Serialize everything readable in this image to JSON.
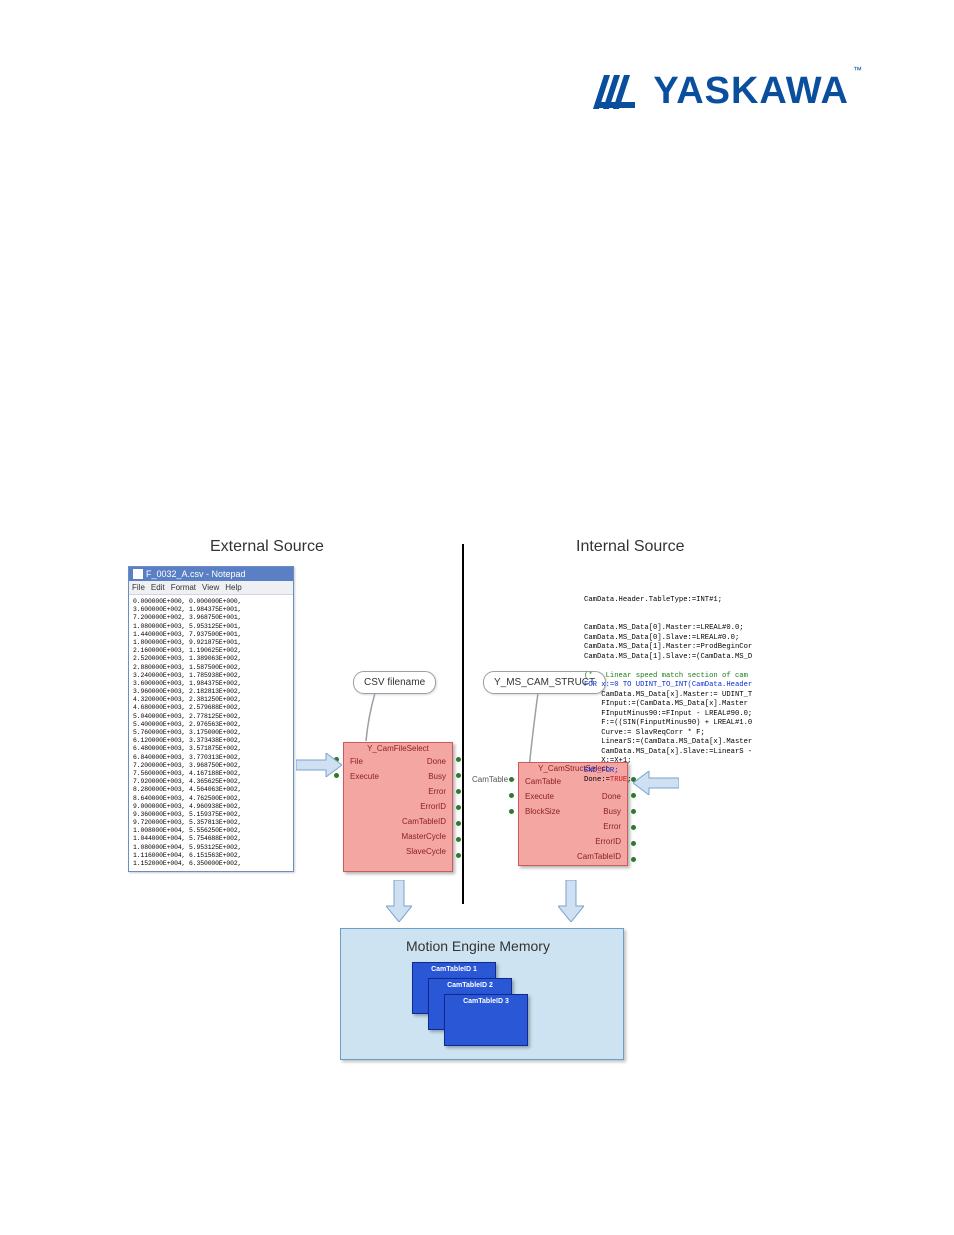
{
  "logo": {
    "brand": "YASKAWA",
    "tm": "™"
  },
  "headings": {
    "external": "External Source",
    "internal": "Internal Source"
  },
  "notepad": {
    "title": "F_0032_A.csv - Notepad",
    "menu": [
      "File",
      "Edit",
      "Format",
      "View",
      "Help"
    ],
    "lines": [
      "0.000000E+000, 0.000000E+000,",
      "3.600000E+002, 1.984375E+001,",
      "7.200000E+002, 3.968750E+001,",
      "1.080000E+003, 5.953125E+001,",
      "1.440000E+003, 7.937500E+001,",
      "1.800000E+003, 9.921875E+001,",
      "2.160000E+003, 1.190625E+002,",
      "2.520000E+003, 1.389063E+002,",
      "2.880000E+003, 1.587500E+002,",
      "3.240000E+003, 1.785938E+002,",
      "3.600000E+003, 1.984375E+002,",
      "3.960000E+003, 2.182813E+002,",
      "4.320000E+003, 2.381250E+002,",
      "4.680000E+003, 2.579688E+002,",
      "5.040000E+003, 2.778125E+002,",
      "5.400000E+003, 2.976563E+002,",
      "5.760000E+003, 3.175000E+002,",
      "6.120000E+003, 3.373438E+002,",
      "6.480000E+003, 3.571875E+002,",
      "6.840000E+003, 3.770313E+002,",
      "7.200000E+003, 3.968750E+002,",
      "7.560000E+003, 4.167188E+002,",
      "7.920000E+003, 4.365625E+002,",
      "8.280000E+003, 4.564063E+002,",
      "8.640000E+003, 4.762500E+002,",
      "9.000000E+003, 4.960938E+002,",
      "9.360000E+003, 5.159375E+002,",
      "9.720000E+003, 5.357813E+002,",
      "1.008000E+004, 5.556250E+002,",
      "1.044000E+004, 5.754688E+002,",
      "1.080000E+004, 5.953125E+002,",
      "1.116000E+004, 6.151563E+002,",
      "1.152000E+004, 6.350000E+002,"
    ]
  },
  "callouts": {
    "csv": "CSV filename",
    "struct": "Y_MS_CAM_STRUCT"
  },
  "fb1": {
    "title": "Y_CamFileSelect",
    "left": [
      "File",
      "Execute",
      "",
      "",
      "",
      "",
      ""
    ],
    "right": [
      "Done",
      "Busy",
      "Error",
      "ErrorID",
      "CamTableID",
      "MasterCycle",
      "SlaveCycle"
    ]
  },
  "fb2": {
    "title": "Y_CamStructSelect",
    "left_labels": [
      "CamTable –",
      "",
      ""
    ],
    "left": [
      "CamTable",
      "Execute",
      "BlockSize"
    ],
    "right": [
      "",
      "Done",
      "Busy",
      "Error",
      "ErrorID",
      "CamTableID"
    ]
  },
  "code": {
    "line1": "CamData.Header.TableType:=INT#1;",
    "block1": [
      "CamData.MS_Data[0].Master:=LREAL#0.0;",
      "CamData.MS_Data[0].Slave:=LREAL#0.0;",
      "CamData.MS_Data[1].Master:=ProdBeginCor",
      "CamData.MS_Data[1].Slave:=(CamData.MS_D"
    ],
    "comment": "(*   Linear speed match section of cam",
    "for": "FOR x:=0 TO UDINT_TO_INT(CamData.Header",
    "body": [
      "    CamData.MS_Data[x].Master:= UDINT_T",
      "    FInput:=(CamData.MS_Data[x].Master",
      "    FInputMinus90:=FInput - LREAL#90.0;",
      "    F:=((SIN(FinputMinus90) + LREAL#1.0",
      "    Curve:= SlavReqCorr * F;",
      "    LinearS:=(CamData.MS_Data[x].Master",
      "    CamData.MS_Data[x].Slave:=LinearS -",
      "    X:=X+1;"
    ],
    "endfor": "END_FOR;",
    "done": "Done:=TRUE;"
  },
  "memory": {
    "label": "Motion Engine Memory",
    "tabs": [
      "CamTableID 1",
      "CamTableID 2",
      "CamTableID 3"
    ]
  }
}
